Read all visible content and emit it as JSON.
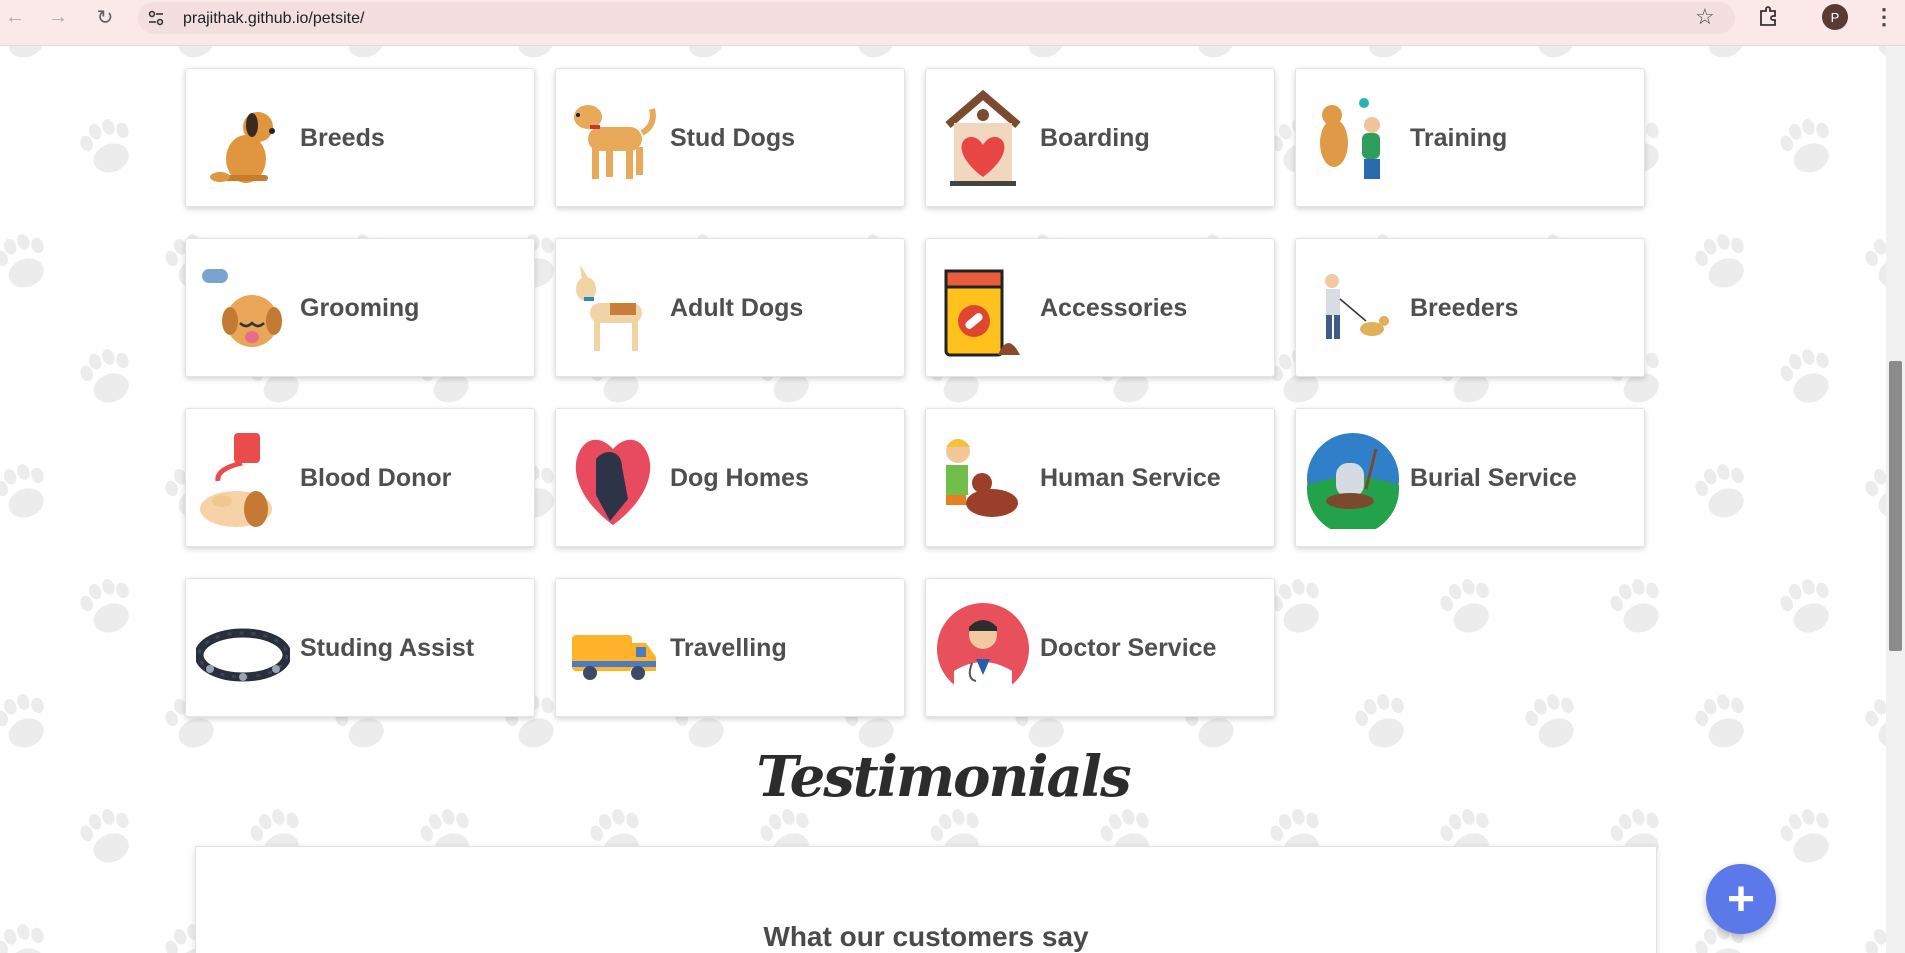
{
  "browser": {
    "url": "prajithak.github.io/petsite/",
    "profile_initial": "P",
    "icons": [
      "back-icon",
      "forward-icon",
      "reload-icon",
      "site-settings-icon",
      "bookmark-star-icon",
      "extensions-icon",
      "menu-icon"
    ]
  },
  "services": [
    {
      "label": "Breeds",
      "icon": "sitting-dog-icon"
    },
    {
      "label": "Stud Dogs",
      "icon": "standing-dog-icon"
    },
    {
      "label": "Boarding",
      "icon": "dog-house-heart-icon"
    },
    {
      "label": "Training",
      "icon": "dog-training-icon"
    },
    {
      "label": "Grooming",
      "icon": "dog-dryer-icon"
    },
    {
      "label": "Adult Dogs",
      "icon": "adult-dog-icon"
    },
    {
      "label": "Accessories",
      "icon": "dog-food-bag-icon"
    },
    {
      "label": "Breeders",
      "icon": "dog-walker-icon"
    },
    {
      "label": "Blood Donor",
      "icon": "blood-bag-dog-icon"
    },
    {
      "label": "Dog Homes",
      "icon": "heart-dog-icon"
    },
    {
      "label": "Human Service",
      "icon": "boy-with-dog-icon"
    },
    {
      "label": "Burial Service",
      "icon": "rip-grave-icon"
    },
    {
      "label": "Studing Assist",
      "icon": "spiked-collar-icon"
    },
    {
      "label": "Travelling",
      "icon": "van-icon"
    },
    {
      "label": "Doctor Service",
      "icon": "doctor-icon"
    }
  ],
  "testimonials": {
    "title": "Testimonials",
    "subtitle": "What our customers say"
  },
  "fab": {
    "label": "+"
  },
  "colors": {
    "accent": "#5b79e8",
    "banner_red": "#dd2b2b",
    "chrome": "#fbe9ea"
  }
}
